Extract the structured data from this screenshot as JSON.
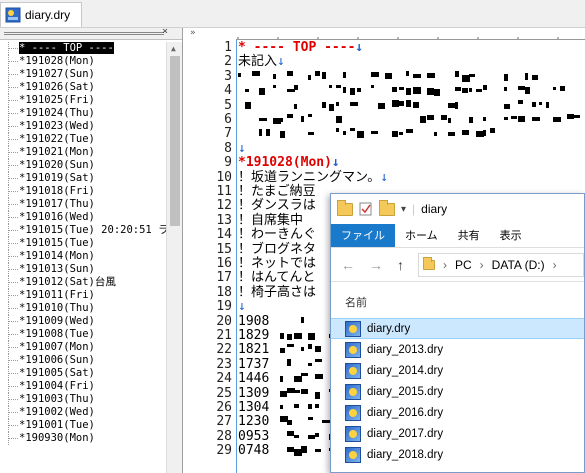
{
  "tab": {
    "title": "diary.dry"
  },
  "tree": {
    "close_glyph": "×",
    "items": [
      "* ---- TOP ----",
      "*191028(Mon)",
      "*191027(Sun)",
      "*191026(Sat)",
      "*191025(Fri)",
      "*191024(Thu)",
      "*191023(Wed)",
      "*191022(Tue)",
      "*191021(Mon)",
      "*191020(Sun)",
      "*191019(Sat)",
      "*191018(Fri)",
      "*191017(Thu)",
      "*191016(Wed)",
      "*191015(Tue) 20:20:51 ラ",
      "*191015(Tue)",
      "*191014(Mon)",
      "*191013(Sun)",
      "*191012(Sat)台風",
      "*191011(Fri)",
      "*191010(Thu)",
      "*191009(Wed)",
      "*191008(Tue)",
      "*191007(Mon)",
      "*191006(Sun)",
      "*191005(Sat)",
      "*191004(Fri)",
      "*191003(Thu)",
      "*191002(Wed)",
      "*191001(Tue)",
      "*190930(Mon)"
    ]
  },
  "editor": {
    "margin_mark": "»",
    "lines": [
      {
        "n": "1",
        "text": "* ---- TOP ----",
        "style": "red",
        "eol": "↓"
      },
      {
        "n": "2",
        "text": "未記入",
        "style": "",
        "eol": "↓"
      },
      {
        "n": "3",
        "text": "",
        "style": "",
        "eol": ""
      },
      {
        "n": "4",
        "text": "",
        "style": "",
        "eol": ""
      },
      {
        "n": "5",
        "text": "",
        "style": "",
        "eol": ""
      },
      {
        "n": "6",
        "text": "",
        "style": "",
        "eol": ""
      },
      {
        "n": "7",
        "text": "",
        "style": "",
        "eol": ""
      },
      {
        "n": "8",
        "text": "",
        "style": "",
        "eol": "↓"
      },
      {
        "n": "9",
        "text": "*191028(Mon)",
        "style": "red",
        "eol": "↓"
      },
      {
        "n": "10",
        "text": "！坂道ランニングマン。",
        "style": "",
        "eol": "↓"
      },
      {
        "n": "11",
        "text": "！たまご納豆",
        "style": "",
        "eol": ""
      },
      {
        "n": "12",
        "text": "！ダンスラは",
        "style": "",
        "eol": ""
      },
      {
        "n": "13",
        "text": "！自席集中",
        "style": "",
        "eol": ""
      },
      {
        "n": "14",
        "text": "！わーきんぐ",
        "style": "",
        "eol": ""
      },
      {
        "n": "15",
        "text": "！ブログネタ",
        "style": "",
        "eol": ""
      },
      {
        "n": "16",
        "text": "！ネットでは",
        "style": "",
        "eol": ""
      },
      {
        "n": "17",
        "text": "！はんてんと",
        "style": "",
        "eol": ""
      },
      {
        "n": "18",
        "text": "！椅子高さは",
        "style": "",
        "eol": ""
      },
      {
        "n": "19",
        "text": "",
        "style": "",
        "eol": "↓"
      },
      {
        "n": "20",
        "text": "1908",
        "style": "",
        "eol": ""
      },
      {
        "n": "21",
        "text": "1829",
        "style": "",
        "eol": ""
      },
      {
        "n": "22",
        "text": "1821",
        "style": "",
        "eol": ""
      },
      {
        "n": "23",
        "text": "1737",
        "style": "",
        "eol": ""
      },
      {
        "n": "24",
        "text": "1446",
        "style": "",
        "eol": ""
      },
      {
        "n": "25",
        "text": "1309",
        "style": "",
        "eol": ""
      },
      {
        "n": "26",
        "text": "1304",
        "style": "",
        "eol": ""
      },
      {
        "n": "27",
        "text": "1230",
        "style": "",
        "eol": ""
      },
      {
        "n": "28",
        "text": "0953",
        "style": "",
        "eol": ""
      },
      {
        "n": "29",
        "text": "0748",
        "style": "",
        "eol": ""
      }
    ]
  },
  "explorer": {
    "title": "diary",
    "ribbon_tabs": [
      "ファイル",
      "ホーム",
      "共有",
      "表示"
    ],
    "nav": {
      "back": "←",
      "forward": "→",
      "up": "↑"
    },
    "address": [
      "PC",
      "DATA (D:)"
    ],
    "column_header": "名前",
    "files": [
      "diary.dry",
      "diary_2013.dry",
      "diary_2014.dry",
      "diary_2015.dry",
      "diary_2016.dry",
      "diary_2017.dry",
      "diary_2018.dry"
    ],
    "selected_index": 0
  }
}
